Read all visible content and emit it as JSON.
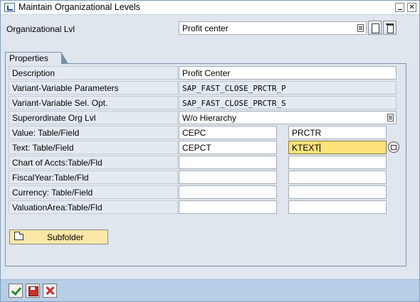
{
  "window": {
    "title": "Maintain Organizational Levels"
  },
  "header": {
    "label": "Organizational Lvl",
    "value": "Profit center"
  },
  "properties": {
    "tab_label": "Properties",
    "rows": [
      {
        "label": "Description",
        "value": "Profit Center"
      },
      {
        "label": "Variant-Variable Parameters",
        "value": "SAP_FAST_CLOSE_PRCTR_P"
      },
      {
        "label": "Variant-Variable Sel. Opt.",
        "value": "SAP_FAST_CLOSE_PRCTR_S"
      },
      {
        "label": "Superordinate Org Lvl",
        "value": "W/o Hierarchy"
      },
      {
        "label": "Value: Table/Field",
        "table": "CEPC",
        "field": "PRCTR"
      },
      {
        "label": "Text: Table/Field",
        "table": "CEPCT",
        "field": "KTEXT"
      },
      {
        "label": "Chart of Accts:Table/Fld",
        "table": "",
        "field": ""
      },
      {
        "label": "FiscalYear:Table/Fld",
        "table": "",
        "field": ""
      },
      {
        "label": "Currency: Table/Field",
        "table": "",
        "field": ""
      },
      {
        "label": "ValuationArea:Table/Fld",
        "table": "",
        "field": ""
      }
    ],
    "subfolder_label": "Subfolder"
  },
  "footer": {
    "icons": [
      "check-icon",
      "save-icon",
      "cancel-icon"
    ]
  }
}
